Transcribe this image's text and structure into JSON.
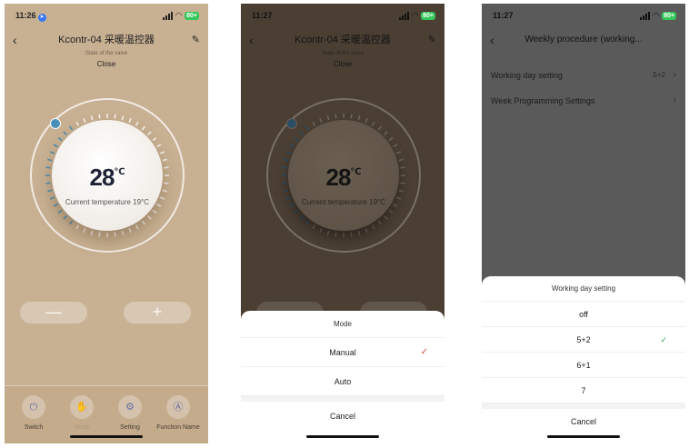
{
  "panel1": {
    "status": {
      "time": "11:26",
      "battery": "80+"
    },
    "nav": {
      "title": "Kcontr-04 采暖温控器"
    },
    "valve": {
      "label": "State of the valve",
      "value": "Close"
    },
    "dial": {
      "temperature": "28",
      "unit": "℃",
      "current": "Current temperature 19°C"
    },
    "controls": {
      "minus": "—",
      "plus": "+"
    },
    "tabs": [
      {
        "label": "Switch",
        "icon": "power-icon"
      },
      {
        "label": "Mode",
        "icon": "hand-icon"
      },
      {
        "label": "Setting",
        "icon": "gear-icon"
      },
      {
        "label": "Function Name",
        "icon": "a-circle-icon"
      }
    ]
  },
  "panel2": {
    "status": {
      "time": "11:27",
      "battery": "80+"
    },
    "nav": {
      "title": "Kcontr-04 采暖温控器"
    },
    "valve": {
      "label": "State of the valve",
      "value": "Close"
    },
    "dial": {
      "temperature": "28",
      "unit": "℃",
      "current": "Current temperature 19°C"
    },
    "sheet": {
      "title": "Mode",
      "options": [
        {
          "label": "Manual",
          "selected": true
        },
        {
          "label": "Auto",
          "selected": false
        }
      ],
      "cancel": "Cancel"
    }
  },
  "panel3": {
    "status": {
      "time": "11:27",
      "battery": "80+"
    },
    "nav": {
      "title": "Weekly procedure (working..."
    },
    "rows": [
      {
        "label": "Working day setting",
        "value": "5+2"
      },
      {
        "label": "Week Programming Settings",
        "value": ""
      }
    ],
    "sheet": {
      "title": "Working day setting",
      "options": [
        {
          "label": "off",
          "selected": false
        },
        {
          "label": "5+2",
          "selected": true
        },
        {
          "label": "6+1",
          "selected": false
        },
        {
          "label": "7",
          "selected": false
        }
      ],
      "cancel": "Cancel"
    }
  },
  "colors": {
    "panel1_bg": "#c8b092",
    "accent_blue": "#4a8fb5",
    "check_red": "#e0453a",
    "check_green": "#35a356"
  }
}
